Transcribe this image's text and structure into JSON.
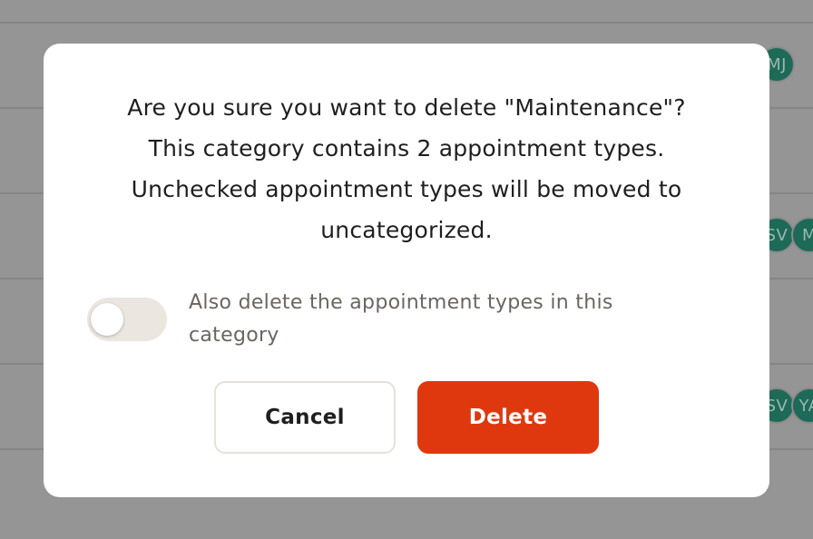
{
  "background": {
    "avatars": [
      {
        "initials": "MJ"
      },
      {
        "initials": "SV"
      },
      {
        "initials": "M"
      },
      {
        "initials": "SV"
      },
      {
        "initials": "YA"
      }
    ]
  },
  "dialog": {
    "message": "Are you sure you want to delete \"Maintenance\"?\nThis category contains 2 appointment types.\nUnchecked appointment types will be moved to\nuncategorized.",
    "toggle": {
      "label": "Also delete the appointment types in this category",
      "checked": false
    },
    "cancel_label": "Cancel",
    "delete_label": "Delete"
  },
  "colors": {
    "accent_delete": "#e0380e",
    "avatar": "#1d6a58",
    "toggle_off": "#ebe6e0"
  }
}
